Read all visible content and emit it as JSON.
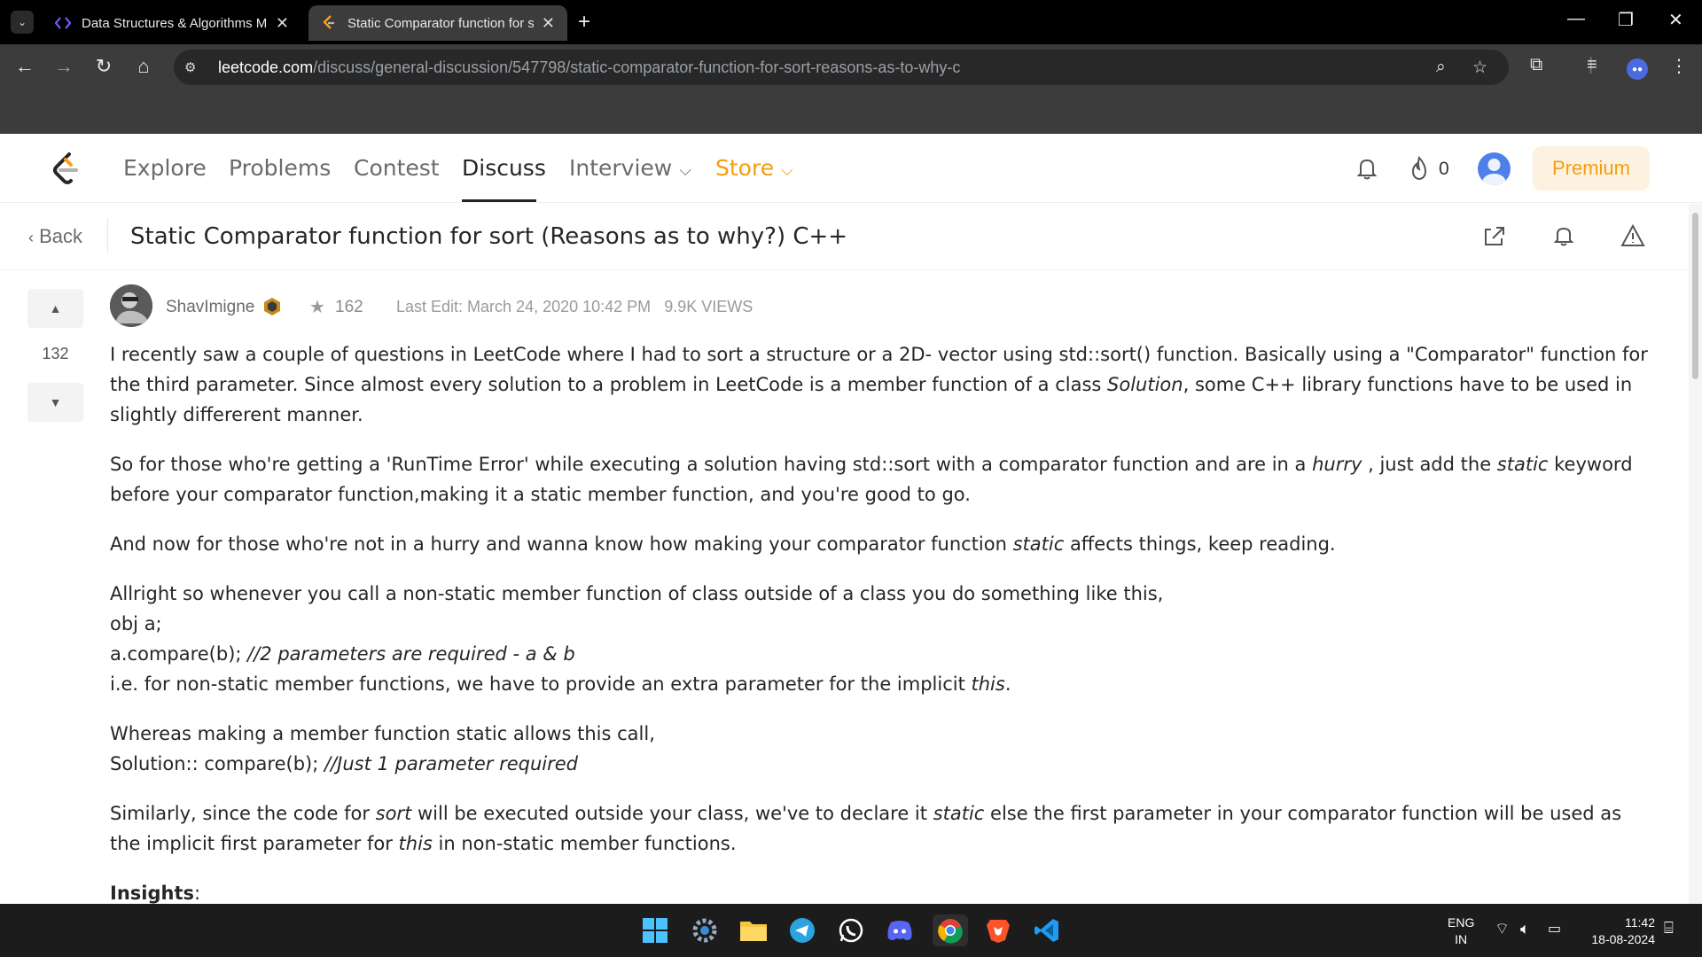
{
  "browser": {
    "tabs": [
      {
        "title": "Data Structures & Algorithms M",
        "active": false
      },
      {
        "title": "Static Comparator function for s",
        "active": true
      }
    ],
    "url_host": "leetcode.com",
    "url_path": "/discuss/general-discussion/547798/static-comparator-function-for-sort-reasons-as-to-why-c"
  },
  "nav": {
    "items": [
      "Explore",
      "Problems",
      "Contest",
      "Discuss",
      "Interview",
      "Store"
    ],
    "active": "Discuss",
    "fire_count": "0",
    "premium_label": "Premium"
  },
  "post": {
    "back_label": "Back",
    "title": "Static Comparator function for sort (Reasons as to why?) C++",
    "votes": "132",
    "author": "ShavImigne",
    "reputation": "162",
    "last_edit": "Last Edit: March 24, 2020 10:42 PM",
    "views": "9.9K VIEWS"
  },
  "colors": {
    "accent_orange": "#f59e0b",
    "text_dark": "#262626",
    "text_muted": "#6b6b6b"
  },
  "taskbar": {
    "lang_top": "ENG",
    "lang_bottom": "IN",
    "time": "11:42",
    "date": "18-08-2024"
  }
}
